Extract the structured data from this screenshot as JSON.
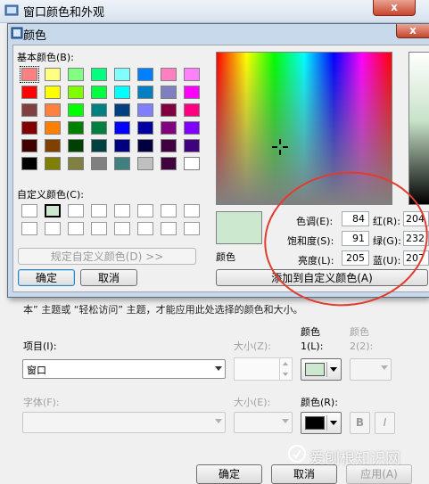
{
  "back_window": {
    "title": "窗口颜色和外观",
    "close_label": "x",
    "notice": "本” 主题或 “轻松访问” 主题，才能应用此处选择的颜色和大小。",
    "item_label": "项目(I):",
    "item_value": "窗口",
    "size_label": "大小(Z):",
    "color1_label_a": "颜色",
    "color1_label_b": "1(L):",
    "color2_label_a": "颜色",
    "color2_label_b": "2(2):",
    "font_label": "字体(F):",
    "font_size_label": "大小(E):",
    "font_color_label": "颜色(R):",
    "bold_label": "B",
    "italic_label": "I",
    "ok_label": "确定",
    "cancel_label": "取消",
    "apply_label": "应用(A)",
    "color1_value": "#cce8cf",
    "font_color_value": "#000000"
  },
  "color_dialog": {
    "title": "颜色",
    "close_label": "x",
    "basic_colors_label": "基本颜色(B):",
    "basic_colors": [
      [
        "#ff8080",
        "#ffff80",
        "#80ff80",
        "#00ff80",
        "#80ffff",
        "#0080ff",
        "#ff80c0",
        "#ff80ff"
      ],
      [
        "#ff0000",
        "#ffff00",
        "#80ff00",
        "#00ff40",
        "#00ffff",
        "#0080c0",
        "#8080c0",
        "#ff00ff"
      ],
      [
        "#804040",
        "#ff8040",
        "#00ff00",
        "#008080",
        "#004080",
        "#8080ff",
        "#800040",
        "#ff0080"
      ],
      [
        "#800000",
        "#ff8000",
        "#008000",
        "#008040",
        "#0000ff",
        "#0000a0",
        "#800080",
        "#8000ff"
      ],
      [
        "#400000",
        "#804000",
        "#004000",
        "#004040",
        "#000080",
        "#000040",
        "#400040",
        "#400080"
      ],
      [
        "#000000",
        "#808000",
        "#808040",
        "#808080",
        "#408080",
        "#c0c0c0",
        "#400040",
        "#ffffff"
      ]
    ],
    "custom_colors_label": "自定义颜色(C):",
    "custom_colors": [
      [
        "#ffffff",
        "#cce8cf",
        "#ffffff",
        "#ffffff",
        "#ffffff",
        "#ffffff",
        "#ffffff",
        "#ffffff"
      ],
      [
        "#ffffff",
        "#ffffff",
        "#ffffff",
        "#ffffff",
        "#ffffff",
        "#ffffff",
        "#ffffff",
        "#ffffff"
      ]
    ],
    "define_custom_label": "规定自定义颜色(D) >>",
    "ok_label": "确定",
    "cancel_label": "取消",
    "preview_label": "颜色",
    "preview_color": "#cce8cf",
    "hue_label": "色调(E):",
    "hue_value": "84",
    "sat_label": "饱和度(S):",
    "sat_value": "91",
    "lum_label": "亮度(L):",
    "lum_value": "205",
    "red_label": "红(R):",
    "red_value": "204",
    "green_label": "绿(G):",
    "green_value": "232",
    "blue_label": "蓝(U):",
    "blue_value": "207",
    "add_custom_label": "添加到自定义颜色(A)"
  },
  "watermark": "爱刨根知识网",
  "icons": [
    "app-icon",
    "color-dialog-icon",
    "crosshair-icon",
    "watermark-logo-icon"
  ]
}
